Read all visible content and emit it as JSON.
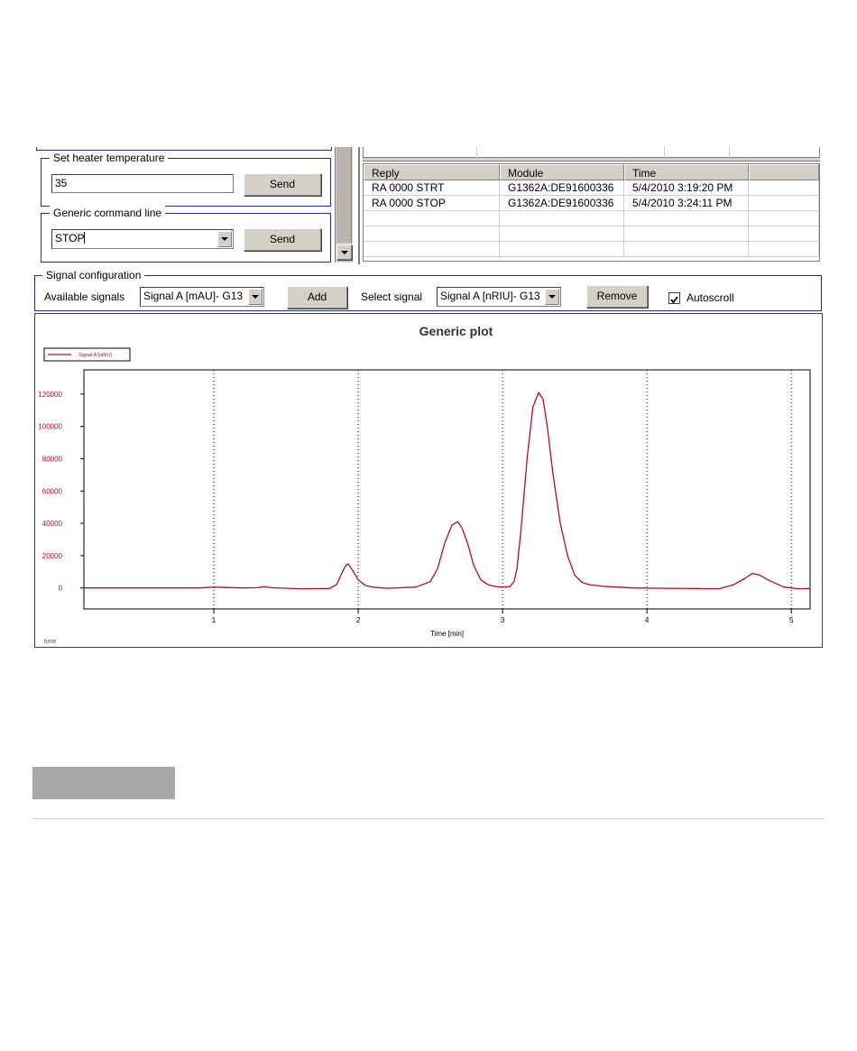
{
  "heater": {
    "label": "Set heater temperature",
    "value": "35",
    "send_label": "Send"
  },
  "command": {
    "label": "Generic command line",
    "value": "STOP",
    "send_label": "Send"
  },
  "reply_table": {
    "columns": [
      "Reply",
      "Module",
      "Time"
    ],
    "rows": [
      [
        "RA 0000 STRT",
        "G1362A:DE91600336",
        "5/4/2010 3:19:20 PM"
      ],
      [
        "RA 0000 STOP",
        "G1362A:DE91600336",
        "5/4/2010 3:24:11 PM"
      ]
    ]
  },
  "signal_config": {
    "label": "Signal configuration",
    "available_label": "Available signals",
    "available_value": "Signal A [mAU]- G13",
    "add_label": "Add",
    "select_label": "Select signal",
    "select_value": "Signal A [nRIU]- G13",
    "remove_label": "Remove",
    "autoscroll_label": "Autoscroll",
    "autoscroll_checked": true
  },
  "chart_data": {
    "type": "line",
    "title": "Generic plot",
    "xlabel": "Time [min]",
    "ylabel": "",
    "corner_label": "time",
    "xlim": [
      0.1,
      5.13
    ],
    "ylim": [
      -13000,
      135000
    ],
    "x_ticks": [
      1,
      2,
      3,
      4,
      5
    ],
    "y_ticks": [
      0,
      20000,
      40000,
      60000,
      80000,
      100000,
      120000
    ],
    "grid": "vertical dotted at x ticks",
    "legend": "top-left",
    "series": [
      {
        "name": "Signal A [nRIU]",
        "color": "#b01020",
        "x": [
          0.1,
          0.5,
          0.9,
          1.0,
          1.2,
          1.3,
          1.35,
          1.4,
          1.6,
          1.8,
          1.85,
          1.88,
          1.91,
          1.93,
          1.96,
          2.0,
          2.05,
          2.1,
          2.2,
          2.4,
          2.5,
          2.55,
          2.6,
          2.65,
          2.69,
          2.72,
          2.76,
          2.8,
          2.85,
          2.9,
          2.95,
          3.0,
          3.05,
          3.08,
          3.1,
          3.13,
          3.17,
          3.21,
          3.25,
          3.28,
          3.31,
          3.35,
          3.4,
          3.45,
          3.5,
          3.55,
          3.6,
          3.7,
          3.8,
          3.9,
          4.1,
          4.3,
          4.5,
          4.6,
          4.68,
          4.73,
          4.78,
          4.85,
          4.95,
          5.05,
          5.13
        ],
        "y": [
          0,
          0,
          0,
          500,
          0,
          200,
          800,
          100,
          -500,
          -300,
          2000,
          8000,
          13500,
          15000,
          11000,
          5000,
          1500,
          500,
          -200,
          500,
          4000,
          12000,
          28000,
          39000,
          41000,
          37000,
          27000,
          14000,
          5000,
          2000,
          900,
          500,
          800,
          4000,
          12000,
          38000,
          80000,
          112000,
          121000,
          117000,
          100000,
          70000,
          40000,
          20000,
          8000,
          3500,
          2000,
          1000,
          500,
          0,
          -200,
          -300,
          -500,
          2000,
          6000,
          9000,
          8000,
          4500,
          500,
          -500,
          -300
        ]
      }
    ]
  }
}
